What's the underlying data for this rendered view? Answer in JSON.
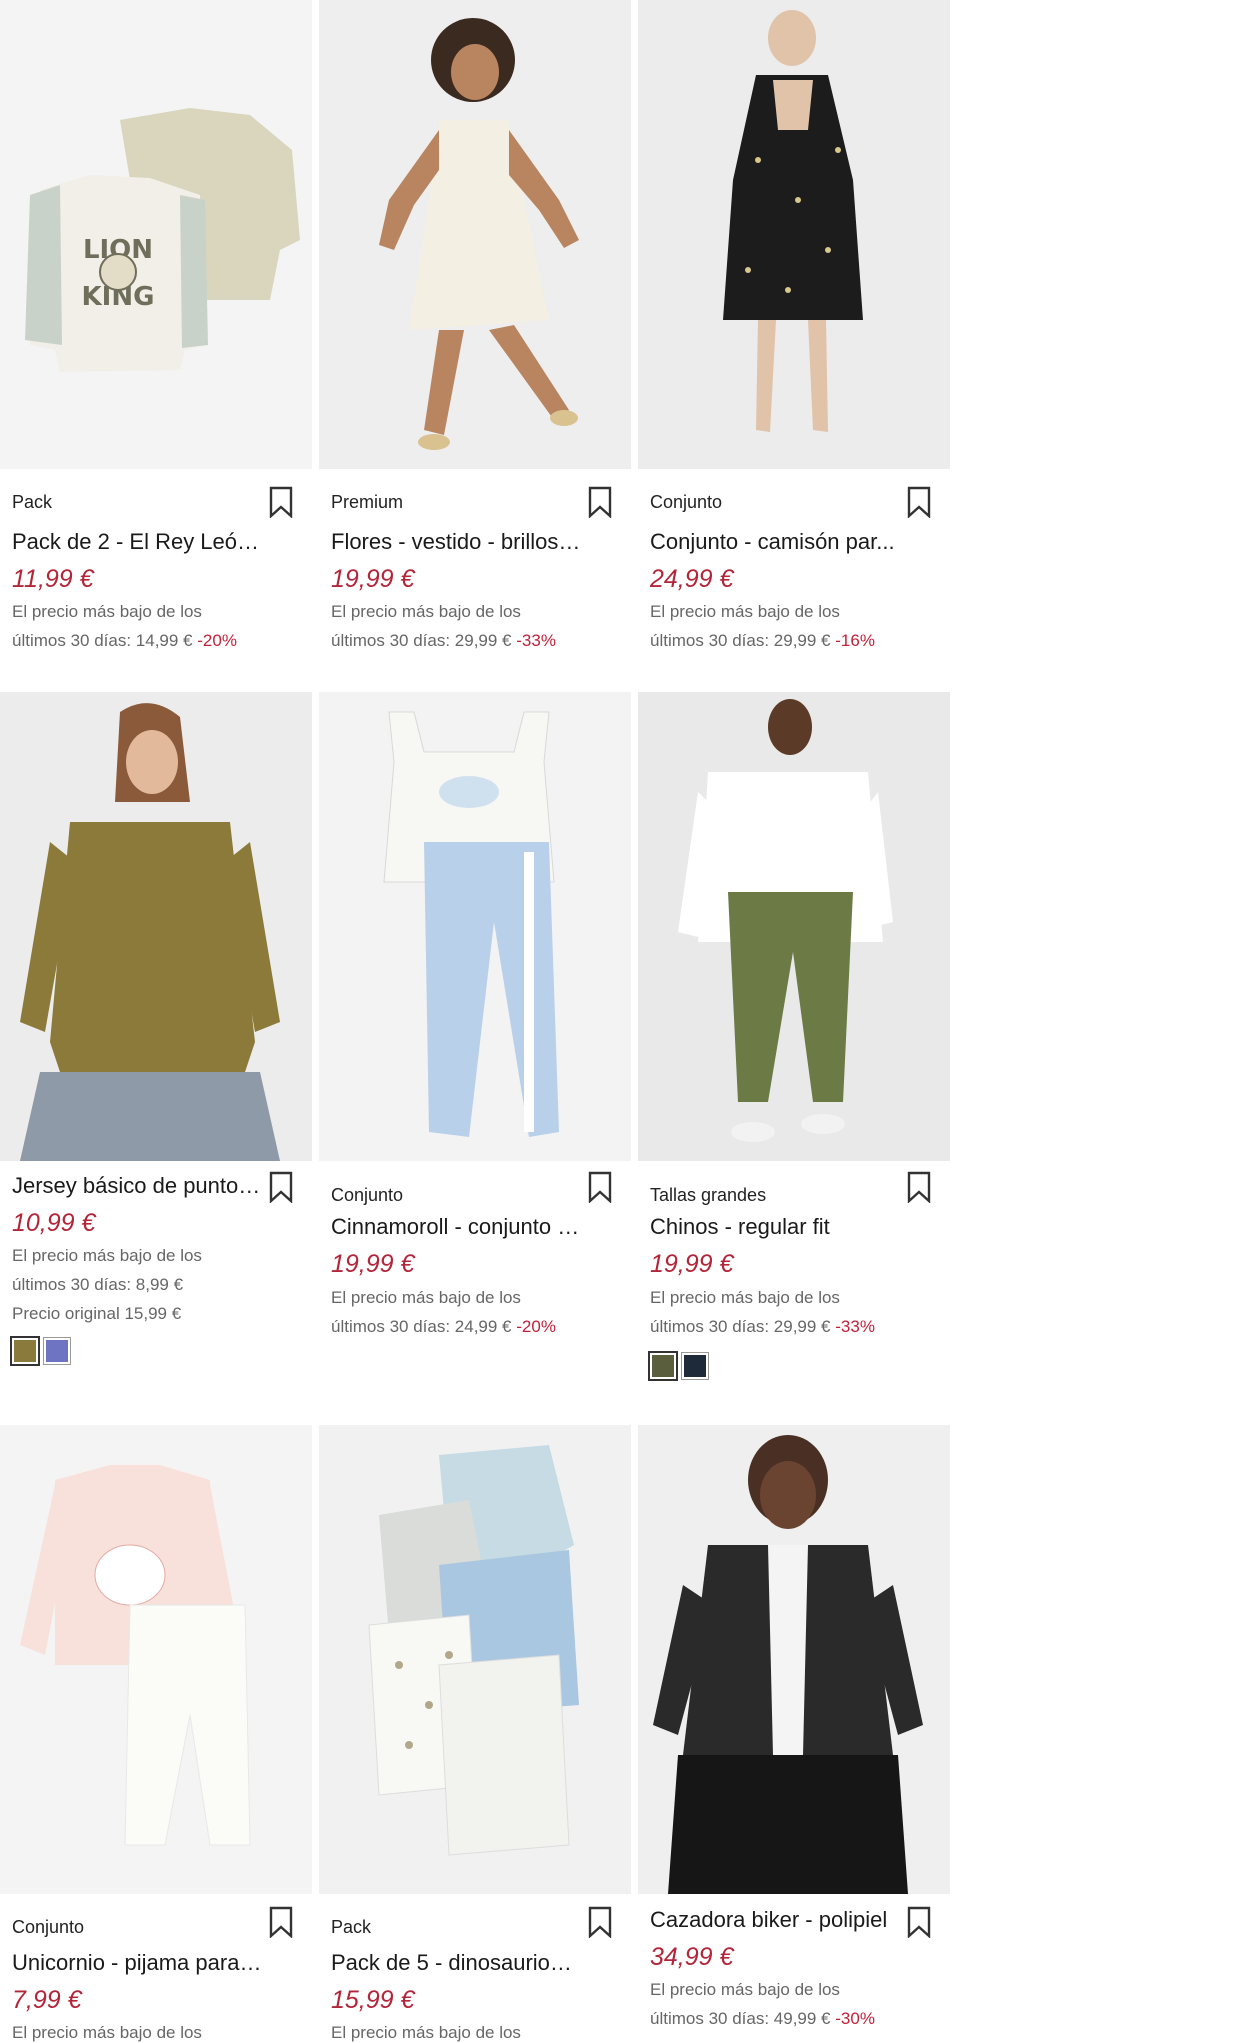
{
  "products": [
    {
      "tag": "Pack",
      "title": "Pack de 2 - El Rey León ...",
      "price": "11,99 €",
      "note1": "El precio más bajo de los",
      "note2": "últimos 30 días: 14,99 €",
      "discount": "-20%"
    },
    {
      "tag": "Premium",
      "title": "Flores - vestido - brillos ...",
      "price": "19,99 €",
      "note1": "El precio más bajo de los",
      "note2": "últimos 30 días: 29,99 €",
      "discount": "-33%"
    },
    {
      "tag": "Conjunto",
      "title": "Conjunto - camisón par...",
      "price": "24,99 €",
      "note1": "El precio más bajo de los",
      "note2": "últimos 30 días: 29,99 €",
      "discount": "-16%"
    },
    {
      "tag": "",
      "title": "Jersey básico de punto f...",
      "price": "10,99 €",
      "note1": "El precio más bajo de los",
      "note2": "últimos 30 días: 8,99 €",
      "note3": "Precio original 15,99 €",
      "discount": "",
      "swatches": [
        "#8a7a3c",
        "#6f74c2"
      ]
    },
    {
      "tag": "Conjunto",
      "title": "Cinnamoroll - conjunto -...",
      "price": "19,99 €",
      "note1": "El precio más bajo de los",
      "note2": "últimos 30 días: 24,99 €",
      "discount": "-20%"
    },
    {
      "tag": "Tallas grandes",
      "title": "Chinos - regular fit",
      "price": "19,99 €",
      "note1": "El precio más bajo de los",
      "note2": "últimos 30 días: 29,99 €",
      "discount": "-33%",
      "swatches": [
        "#5a5e3c",
        "#1e2a3a"
      ]
    },
    {
      "tag": "Conjunto",
      "title": "Unicornio - pijama para ...",
      "price": "7,99 €",
      "note1": "El precio más bajo de los",
      "note2": "",
      "discount": ""
    },
    {
      "tag": "Pack",
      "title": "Pack de 5 - dinosaurios ...",
      "price": "15,99 €",
      "note1": "El precio más bajo de los",
      "note2": "",
      "discount": ""
    },
    {
      "tag": "",
      "title": "Cazadora biker - polipiel",
      "price": "34,99 €",
      "note1": "El precio más bajo de los",
      "note2": "últimos 30 días: 49,99 €",
      "discount": "-30%"
    }
  ],
  "icons": {
    "bookmark": "bookmark-icon"
  },
  "colors": {
    "price": "#b3263a",
    "discount": "#c0223a"
  }
}
